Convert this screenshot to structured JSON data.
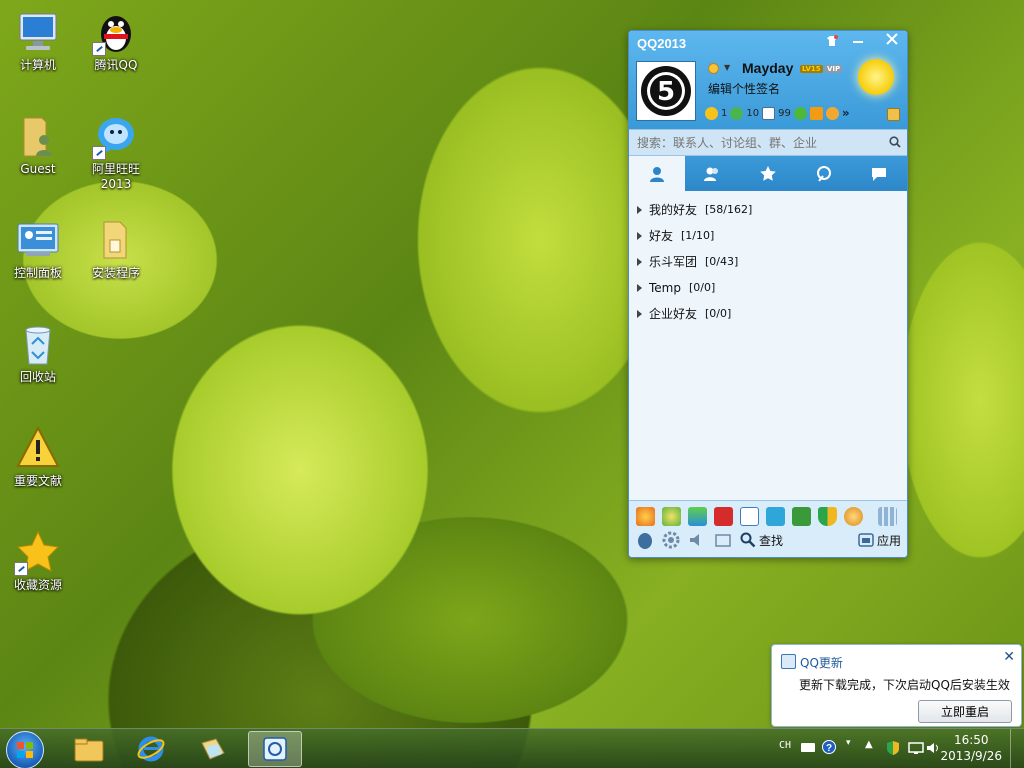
{
  "desktop": {
    "icons": [
      {
        "label": "计算机",
        "name": "computer-icon"
      },
      {
        "label": "腾讯QQ",
        "name": "qq-penguin-icon"
      },
      {
        "label": "Guest",
        "name": "user-folder-icon"
      },
      {
        "label": "阿里旺旺2013",
        "name": "aliwangwang-icon"
      },
      {
        "label": "控制面板",
        "name": "control-panel-icon"
      },
      {
        "label": "安装程序",
        "name": "installer-folder-icon"
      },
      {
        "label": "回收站",
        "name": "recycle-bin-icon"
      },
      {
        "label": "重要文献",
        "name": "warning-icon"
      },
      {
        "label": "收藏资源",
        "name": "star-icon"
      }
    ]
  },
  "qq": {
    "title": "QQ2013",
    "nickname": "Mayday",
    "level_badge": "LV15",
    "vip_badge": "VIP",
    "signature": "编辑个性签名",
    "avatar_text": "5",
    "stat_1": "1",
    "stat_2": "10",
    "stat_3": "99",
    "more": "»",
    "search_placeholder": "搜索：联系人、讨论组、群、企业",
    "groups": [
      {
        "name": "我的好友",
        "count": "[58/162]"
      },
      {
        "name": "好友",
        "count": "[1/10]"
      },
      {
        "name": "乐斗军团",
        "count": "[0/43]"
      },
      {
        "name": "Temp",
        "count": "[0/0]"
      },
      {
        "name": "企业好友",
        "count": "[0/0]"
      }
    ],
    "find_label": "查找",
    "apps_label": "应用"
  },
  "notification": {
    "title": "QQ更新",
    "message": "更新下载完成，下次启动QQ后安装生效",
    "button": "立即重启"
  },
  "taskbar": {
    "lang": "CH",
    "time": "16:50",
    "date": "2013/9/26"
  },
  "colors": {
    "qq_blue": "#3a9ad8",
    "taskbar": "#3c5a22"
  }
}
